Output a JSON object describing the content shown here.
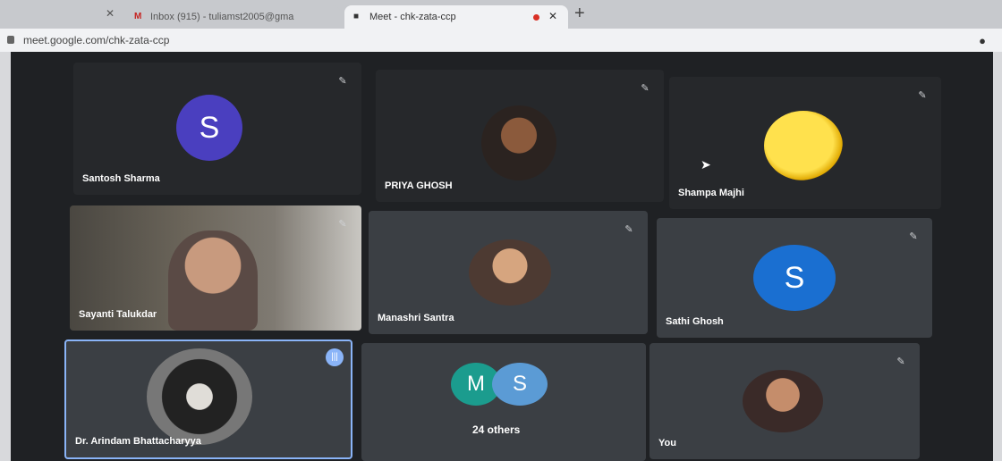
{
  "browser": {
    "tabs": [
      {
        "title": "Inbox (915) - tuliamst2005@gma",
        "icon": "gmail-icon"
      },
      {
        "title": "Meet - chk-zata-ccp",
        "icon": "meet-icon",
        "active": true
      }
    ],
    "url": "meet.google.com/chk-zata-ccp"
  },
  "participants": [
    {
      "name": "Santosh Sharma",
      "initial": "S",
      "avatar_color": "#4a3fbf"
    },
    {
      "name": "PRIYA GHOSH",
      "type": "photo"
    },
    {
      "name": "Shampa Majhi",
      "type": "emoji-avatar"
    },
    {
      "name": "Sayanti Talukdar",
      "type": "video"
    },
    {
      "name": "Manashri Santra",
      "type": "photo"
    },
    {
      "name": "Sathi Ghosh",
      "initial": "S",
      "avatar_color": "#1a6fd1"
    },
    {
      "name": "Dr. Arindam Bhattacharyya",
      "type": "photo",
      "speaking": true
    }
  ],
  "others": {
    "initials": [
      "M",
      "S"
    ],
    "colors": [
      "#1b9c8e",
      "#5b9bd5"
    ],
    "label": "24 others"
  },
  "self": {
    "name": "You"
  }
}
